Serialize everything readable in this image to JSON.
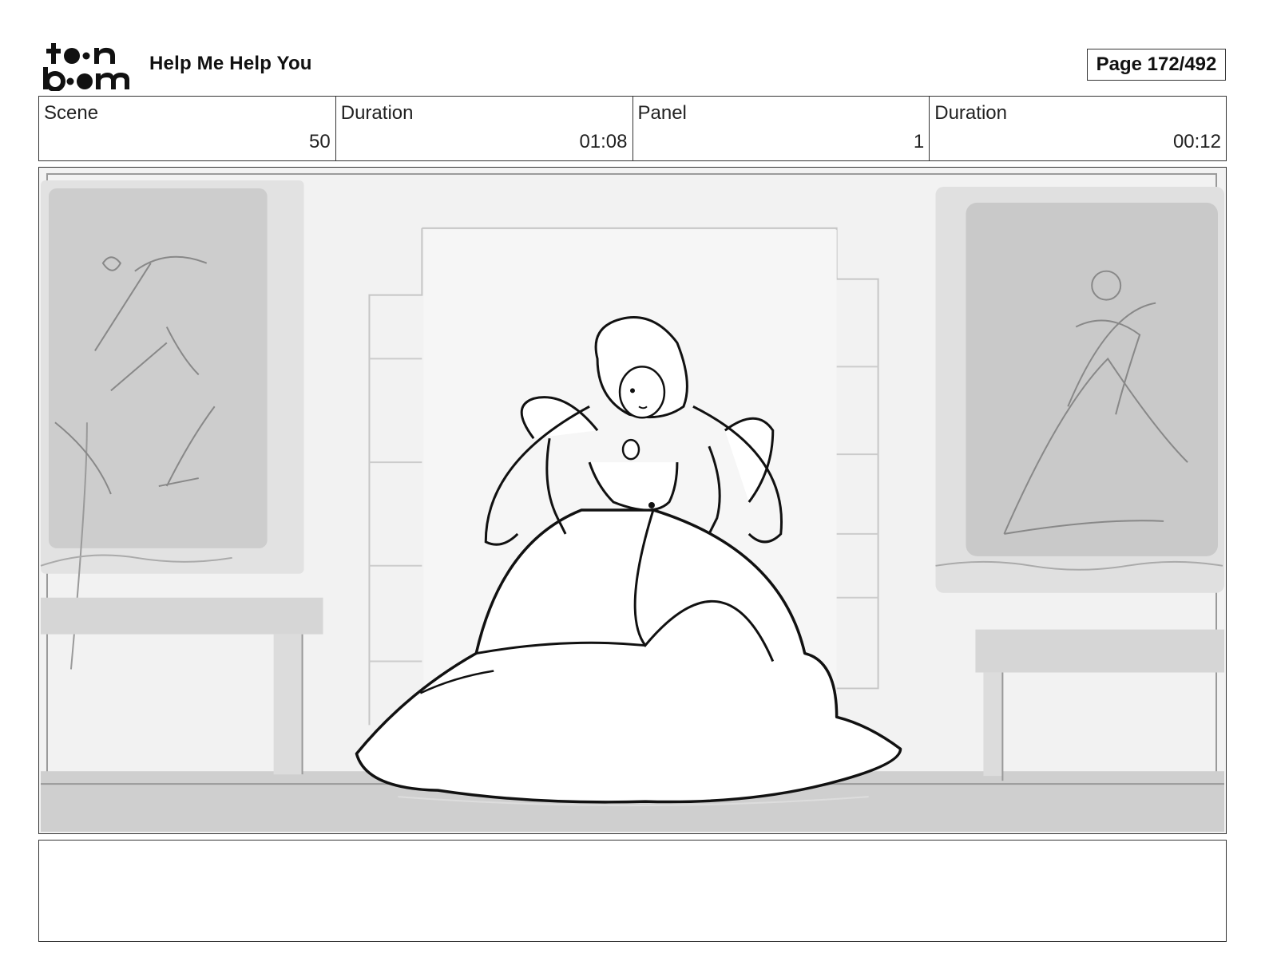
{
  "header": {
    "logo_text": "toon boom",
    "project_title": "Help Me Help You",
    "page_counter": "Page 172/492"
  },
  "info": {
    "scene_label": "Scene",
    "scene_value": "50",
    "scene_duration_label": "Duration",
    "scene_duration_value": "01:08",
    "panel_label": "Panel",
    "panel_value": "1",
    "panel_duration_label": "Duration",
    "panel_duration_value": "00:12"
  },
  "panel": {
    "icon": "storyboard-sketch",
    "colors": {
      "background": "#f2f2f2",
      "shade": "#cfcfcf",
      "line": "#111111"
    }
  },
  "notes": {
    "text": ""
  }
}
